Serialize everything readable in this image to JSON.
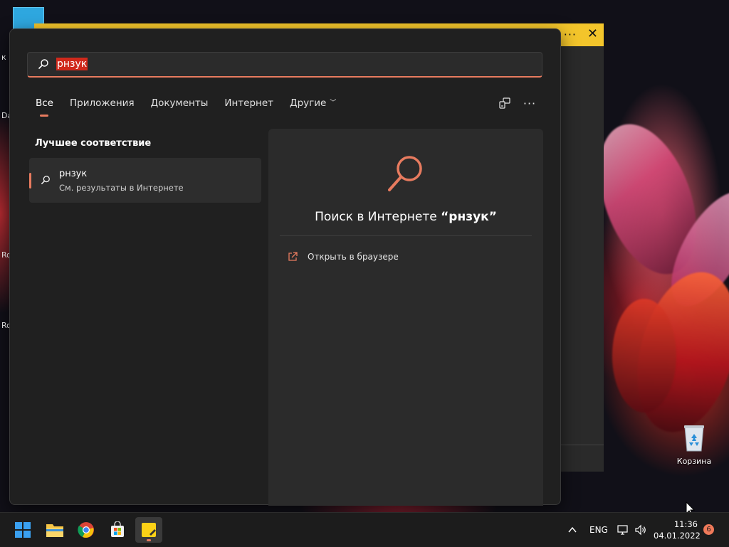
{
  "desktop": {
    "edge_labels": [
      "к",
      "Da",
      "Ro",
      "Ro"
    ],
    "recycle_bin_label": "Корзина"
  },
  "search": {
    "query": "рнзук",
    "tabs": [
      {
        "label": "Все",
        "active": true
      },
      {
        "label": "Приложения",
        "active": false
      },
      {
        "label": "Документы",
        "active": false
      },
      {
        "label": "Интернет",
        "active": false
      },
      {
        "label": "Другие",
        "active": false
      }
    ],
    "best_match_header": "Лучшее соответствие",
    "best_match": {
      "title": "рнзук",
      "subtitle": "См. результаты в Интернете"
    },
    "preview": {
      "title_prefix": "Поиск в Интернете ",
      "title_query": "“рнзук”",
      "action_label": "Открыть в браузере"
    }
  },
  "taskbar": {
    "language": "ENG",
    "time": "11:36",
    "date": "04.01.2022",
    "notification_count": "6"
  },
  "colors": {
    "accent": "#e87b5f",
    "selection": "#d0291b",
    "bg_window_title": "#f3c52b"
  }
}
